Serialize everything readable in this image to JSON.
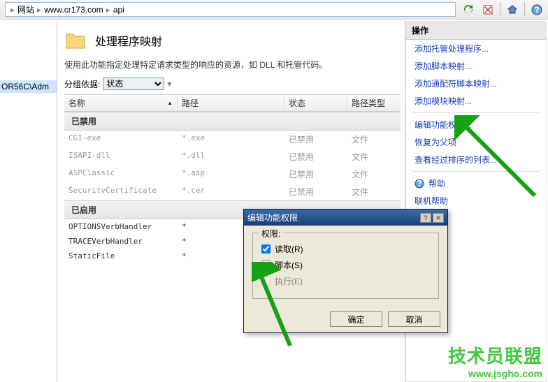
{
  "toolbar": {
    "crumbs": [
      "网站",
      "www.cr173.com",
      "api"
    ]
  },
  "tree": {
    "node1": "OR56C\\Adm"
  },
  "page": {
    "title": "处理程序映射",
    "desc": "使用此功能指定处理特定请求类型的响应的资源，如 DLL 和托管代码。",
    "group_by_label": "分组依据:",
    "group_by_value": "状态"
  },
  "table": {
    "headers": {
      "name": "名称",
      "path": "路径",
      "state": "状态",
      "type": "路径类型"
    },
    "groups": [
      {
        "header": "已禁用",
        "rows": [
          {
            "name": "CGI-exe",
            "path": "*.exe",
            "state": "已禁用",
            "type": "文件"
          },
          {
            "name": "ISAPI-dll",
            "path": "*.dll",
            "state": "已禁用",
            "type": "文件"
          },
          {
            "name": "ASPClassic",
            "path": "*.asp",
            "state": "已禁用",
            "type": "文件"
          },
          {
            "name": "SecurityCertificate",
            "path": "*.cer",
            "state": "已禁用",
            "type": "文件"
          }
        ]
      },
      {
        "header": "已启用",
        "rows": [
          {
            "name": "OPTIONSVerbHandler",
            "path": "*",
            "state": "",
            "type": ""
          },
          {
            "name": "TRACEVerbHandler",
            "path": "*",
            "state": "",
            "type": ""
          },
          {
            "name": "StaticFile",
            "path": "*",
            "state": "",
            "type": ""
          }
        ]
      }
    ]
  },
  "actions": {
    "header": "操作",
    "links": {
      "add_managed": "添加托管处理程序...",
      "add_script": "添加脚本映射...",
      "add_wildcard": "添加通配符脚本映射...",
      "add_module": "添加模块映射...",
      "edit_perm": "编辑功能权限...",
      "revert": "恢复为父项",
      "view_ordered": "查看经过排序的列表...",
      "help": "帮助",
      "online_help": "联机帮助"
    }
  },
  "dialog": {
    "title": "编辑功能权限",
    "group": "权限:",
    "read": "读取(R)",
    "script": "脚本(S)",
    "execute": "执行(E)",
    "ok": "确定",
    "cancel": "取消",
    "values": {
      "read": true,
      "script": false,
      "execute": false,
      "execute_disabled": true
    }
  },
  "watermark": {
    "line1": "技术员联盟",
    "line2": "www.jsgho.com"
  }
}
